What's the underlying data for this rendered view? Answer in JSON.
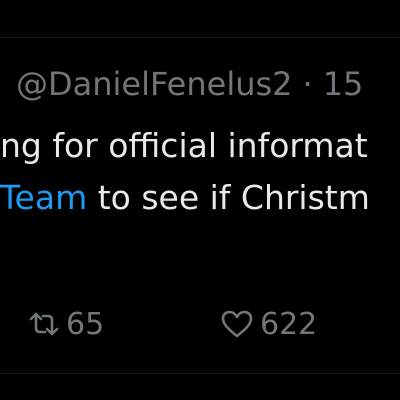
{
  "tweet": {
    "handle": "@DanielFenelus2",
    "separator": "·",
    "timestamp_partial": "15",
    "body_line1": "ng for official informat",
    "mention_partial": "Team",
    "body_line2_rest": " to see if Christm",
    "retweet_count": "65",
    "like_count": "622"
  },
  "colors": {
    "background": "#000000",
    "text": "#e7e9ea",
    "secondary_text": "#71767b",
    "link": "#1d9bf0"
  },
  "icons": {
    "retweet": "retweet-icon",
    "like": "heart-icon"
  }
}
